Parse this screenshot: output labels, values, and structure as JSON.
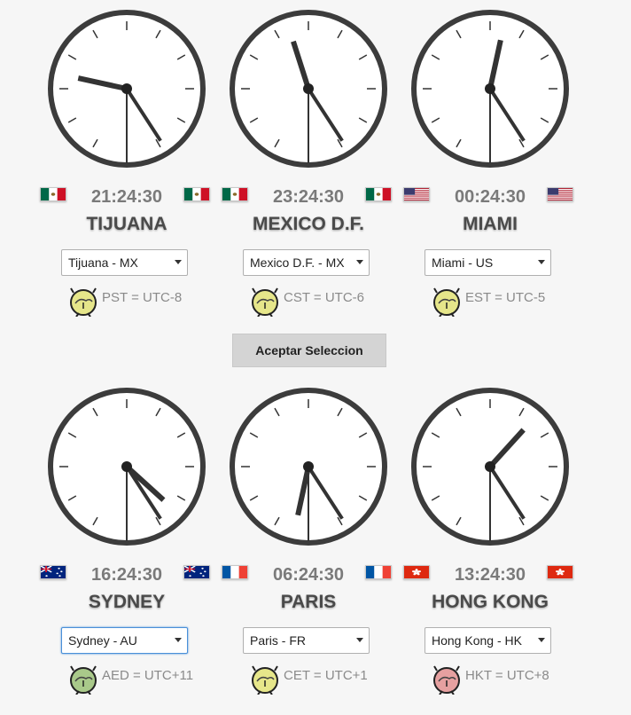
{
  "accept_button": "Aceptar Seleccion",
  "clocks": [
    {
      "city": "TIJUANA",
      "time": "21:24:30",
      "select": "Tijuana - MX",
      "tz": "PST = UTC-8",
      "flag_left": "mexico",
      "flag_right": "mexico",
      "hour": 21,
      "minute": 24,
      "second": 30,
      "icon_color": "#e6e68a"
    },
    {
      "city": "MEXICO D.F.",
      "time": "23:24:30",
      "select": "Mexico D.F. - MX",
      "tz": "CST = UTC-6",
      "flag_left": "mexico",
      "flag_right": "mexico",
      "hour": 23,
      "minute": 24,
      "second": 30,
      "icon_color": "#e6e68a"
    },
    {
      "city": "MIAMI",
      "time": "00:24:30",
      "select": "Miami - US",
      "tz": "EST = UTC-5",
      "flag_left": "usa",
      "flag_right": "usa",
      "hour": 0,
      "minute": 24,
      "second": 30,
      "icon_color": "#e6e68a"
    },
    {
      "city": "SYDNEY",
      "time": "16:24:30",
      "select": "Sydney - AU",
      "tz": "AED = UTC+11",
      "flag_left": "australia",
      "flag_right": "australia",
      "hour": 16,
      "minute": 24,
      "second": 30,
      "icon_color": "#a9c98a"
    },
    {
      "city": "PARIS",
      "time": "06:24:30",
      "select": "Paris - FR",
      "tz": "CET = UTC+1",
      "flag_left": "france",
      "flag_right": "france",
      "hour": 6,
      "minute": 24,
      "second": 30,
      "icon_color": "#e6e68a"
    },
    {
      "city": "HONG KONG",
      "time": "13:24:30",
      "select": "Hong Kong - HK",
      "tz": "HKT = UTC+8",
      "flag_left": "hongkong",
      "flag_right": "hongkong",
      "hour": 13,
      "minute": 24,
      "second": 30,
      "icon_color": "#e6a0a0"
    }
  ]
}
